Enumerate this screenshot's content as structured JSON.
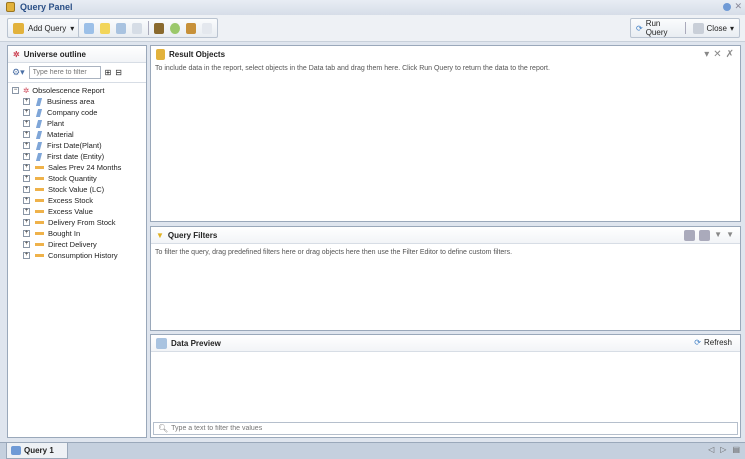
{
  "window": {
    "title": "Query Panel"
  },
  "toolbar": {
    "add_query": "Add Query",
    "run_query": "Run Query",
    "close": "Close"
  },
  "universe": {
    "title": "Universe outline",
    "filter_placeholder": "Type here to filter",
    "root": "Obsolescence Report",
    "items": [
      {
        "label": "Business area",
        "type": "dimension"
      },
      {
        "label": "Company code",
        "type": "dimension"
      },
      {
        "label": "Plant",
        "type": "dimension"
      },
      {
        "label": "Material",
        "type": "dimension"
      },
      {
        "label": "First Date(Plant)",
        "type": "dimension"
      },
      {
        "label": "First date (Entity)",
        "type": "dimension"
      },
      {
        "label": "Sales Prev 24 Months",
        "type": "measure"
      },
      {
        "label": "Stock Quantity",
        "type": "measure"
      },
      {
        "label": "Stock Value (LC)",
        "type": "measure"
      },
      {
        "label": "Excess Stock",
        "type": "measure"
      },
      {
        "label": "Excess Value",
        "type": "measure"
      },
      {
        "label": "Delivery From Stock",
        "type": "measure"
      },
      {
        "label": "Bought In",
        "type": "measure"
      },
      {
        "label": "Direct Delivery",
        "type": "measure"
      },
      {
        "label": "Consumption History",
        "type": "measure"
      }
    ]
  },
  "result_objects": {
    "title": "Result Objects",
    "hint": "To include data in the report, select objects in the Data tab and drag them here. Click Run Query to return the data to the report."
  },
  "query_filters": {
    "title": "Query Filters",
    "hint": "To filter the query, drag predefined filters here or drag objects here then use the Filter Editor to define custom filters."
  },
  "data_preview": {
    "title": "Data Preview",
    "refresh": "Refresh",
    "filter_placeholder": "Type a text to filter the values"
  },
  "tabs": [
    {
      "label": "Query 1"
    }
  ]
}
